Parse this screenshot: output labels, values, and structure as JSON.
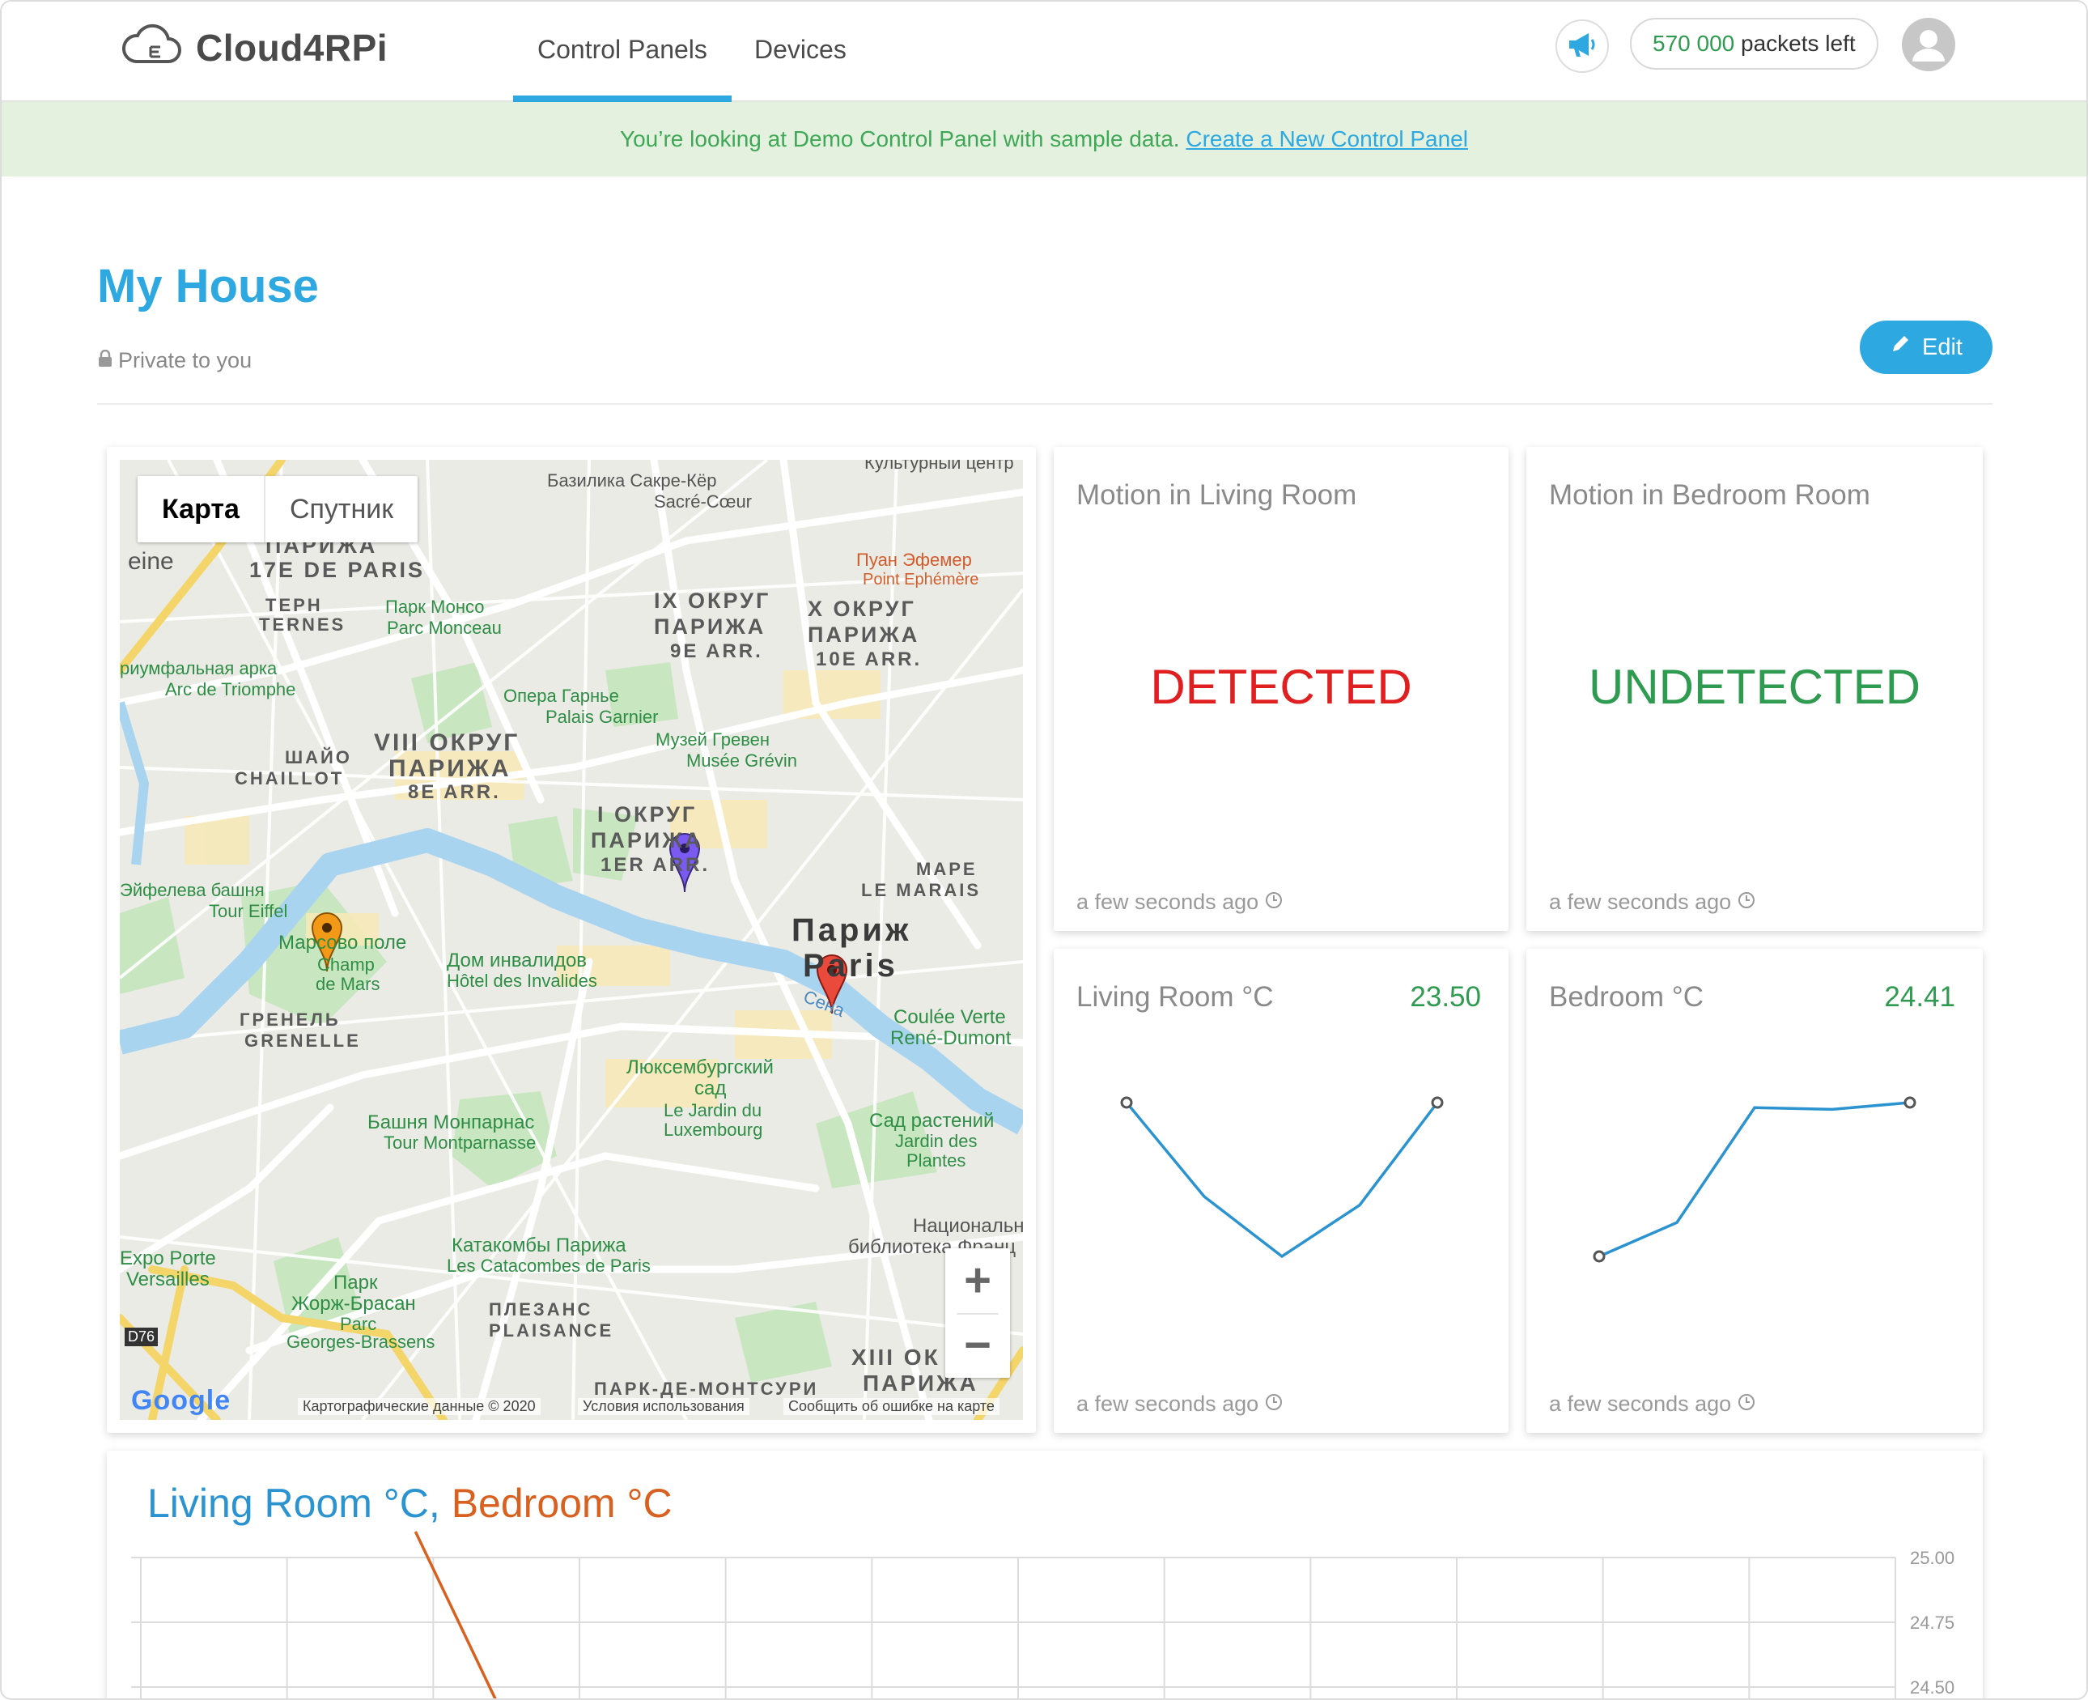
{
  "header": {
    "brand": "Cloud4RPi",
    "tabs": [
      {
        "label": "Control Panels",
        "active": true
      },
      {
        "label": "Devices",
        "active": false
      }
    ],
    "packets_count": "570 000",
    "packets_suffix": "packets left",
    "accent_color": "#2ea8e0"
  },
  "banner": {
    "text": "You’re looking at Demo Control Panel with sample data.",
    "link": "Create a New Control Panel"
  },
  "page": {
    "title": "My House",
    "privacy": "Private to you",
    "edit_label": "Edit"
  },
  "map": {
    "tab_map": "Карта",
    "tab_satellite": "Спутник",
    "zoom_in": "+",
    "zoom_out": "−",
    "copyright": "Картографические данные © 2020",
    "terms": "Условия использования",
    "report": "Сообщить об ошибке на карте",
    "google": "Google",
    "labels": {
      "sacre": "Базилика Сакре-Кёр",
      "sacre_fr": "Sacré-Cœur",
      "culture": "Культурный центр",
      "d17": "ПАРИЖА",
      "d17_fr": "17E DE PARIS",
      "ternes": "ТЕРН",
      "ternes_fr": "TERNES",
      "monceau": "Парк Монсо",
      "monceau_fr": "Parc Monceau",
      "d9a": "IX ОКРУГ",
      "d9b": "ПАРИЖА",
      "d9c": "9E ARR.",
      "d10a": "X ОКРУГ",
      "d10b": "ПАРИЖА",
      "d10c": "10E ARR.",
      "ephemere": "Пуан Эфемер",
      "ephemere_fr": "Point Ephémère",
      "triomphe": "риумфальная арка",
      "triomphe_fr": "Arc de Triomphe",
      "opera": "Опера Гарнье",
      "opera_fr": "Palais Garnier",
      "chaillot": "ШАЙО",
      "chaillot_fr": "CHAILLOT",
      "d8a": "VIII ОКРУГ",
      "d8b": "ПАРИЖА",
      "d8c": "8E ARR.",
      "grevin": "Музей Гревен",
      "grevin_fr": "Musée Grévin",
      "d1a": "I ОКРУГ",
      "d1b": "ПАРИЖА",
      "d1c": "1ER ARR.",
      "marais": "МАРЕ",
      "marais_fr": "LE MARAIS",
      "eiffel": "Эйфелева башня",
      "eiffel_fr": "Tour Eiffel",
      "paris": "Париж",
      "paris_fr": "Paris",
      "mars": "Марсово поле",
      "mars_fr1": "Champ",
      "mars_fr2": "de Mars",
      "invalides": "Дом инвалидов",
      "invalides_fr": "Hôtel des Invalides",
      "seine": "Сена",
      "coulee": "Coulée Verte",
      "coulee2": "René-Dumont",
      "grenelle": "ГРЕНЕЛЬ",
      "grenelle_fr": "GRENELLE",
      "luxembourg1": "Люксембургский",
      "luxembourg2": "сад",
      "luxembourg_fr1": "Le Jardin du",
      "luxembourg_fr2": "Luxembourg",
      "montparnasse": "Башня Монпарнас",
      "montparnasse_fr": "Tour Montparnasse",
      "plantes": "Сад растений",
      "plantes_fr1": "Jardin des",
      "plantes_fr2": "Plantes",
      "national1": "Национальн",
      "national2": "библиотека Франц",
      "expo1": "Expo Porte",
      "expo2": "Versailles",
      "catacombs": "Катакомбы Парижа",
      "catacombs_fr": "Les Catacombes de Paris",
      "brassens1": "Парк",
      "brassens2": "Жорж-Брасан",
      "brassens_fr1": "Parc",
      "brassens_fr2": "Georges-Brassens",
      "plaisance": "ПЛЕЗАНС",
      "plaisance_fr": "PLAISANCE",
      "montsouris": "ПАРК-ДЕ-МОНТСУРИ",
      "d13a": "XIII ОК",
      "d13b": "ПАРИЖА",
      "d76": "D76",
      "seine_left": "eine"
    }
  },
  "widgets": {
    "motion_living": {
      "title": "Motion in Living Room",
      "status": "DETECTED",
      "status_color": "#e02020",
      "time": "a few seconds ago"
    },
    "motion_bedroom": {
      "title": "Motion in Bedroom Room",
      "status": "UNDETECTED",
      "status_color": "#2e9b50",
      "time": "a few seconds ago"
    },
    "temp_living": {
      "title": "Living Room °C",
      "value": "23.50",
      "time": "a few seconds ago"
    },
    "temp_bedroom": {
      "title": "Bedroom °C",
      "value": "24.41",
      "time": "a few seconds ago"
    }
  },
  "bottom_chart": {
    "title_part1": "Living Room °C,",
    "title_part2": "Bedroom °C"
  },
  "chart_data": [
    {
      "type": "line",
      "title": "Living Room °C",
      "series": [
        {
          "name": "Living Room °C",
          "values": [
            24.4,
            23.85,
            23.5,
            23.8,
            24.4
          ]
        }
      ],
      "color": "#2a93d0"
    },
    {
      "type": "line",
      "title": "Bedroom °C",
      "series": [
        {
          "name": "Bedroom °C",
          "values": [
            23.5,
            23.7,
            24.38,
            24.37,
            24.41
          ]
        }
      ],
      "color": "#2a93d0"
    },
    {
      "type": "line",
      "title": "Living Room °C, Bedroom °C",
      "ylim": [
        24.5,
        25.0
      ],
      "ytick_labels": [
        "25.00",
        "24.75",
        "24.50"
      ],
      "grid": true,
      "series": [
        {
          "name": "Bedroom °C",
          "values": [
            25.1,
            24.45
          ],
          "color": "#d9611f"
        }
      ]
    }
  ]
}
